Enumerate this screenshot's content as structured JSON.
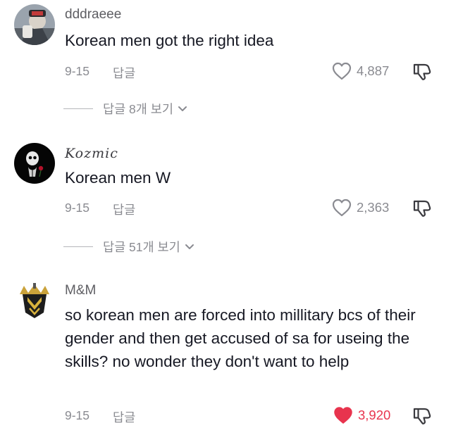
{
  "comments": [
    {
      "username": "dddraeee",
      "text": "Korean men got the right idea",
      "date": "9-15",
      "reply_label": "답글",
      "likes": "4,887",
      "liked": false,
      "view_replies": "답글 8개 보기",
      "avatar_icon": "profile-avatar-icon"
    },
    {
      "username": "Kozmic",
      "text": "Korean men W",
      "date": "9-15",
      "reply_label": "답글",
      "likes": "2,363",
      "liked": false,
      "view_replies": "답글 51개 보기",
      "avatar_icon": "skull-rose-avatar-icon"
    },
    {
      "username": "M&M",
      "text": "so korean men are forced into millitary bcs of their gender and then get accused of sa for useing the skills? no wonder they don't want to help",
      "date": "9-15",
      "reply_label": "답글",
      "likes": "3,920",
      "liked": true,
      "avatar_icon": "emblem-avatar-icon"
    }
  ],
  "colors": {
    "text_primary": "#161823",
    "text_secondary": "#8a8b91",
    "like_active": "#e8344e"
  }
}
